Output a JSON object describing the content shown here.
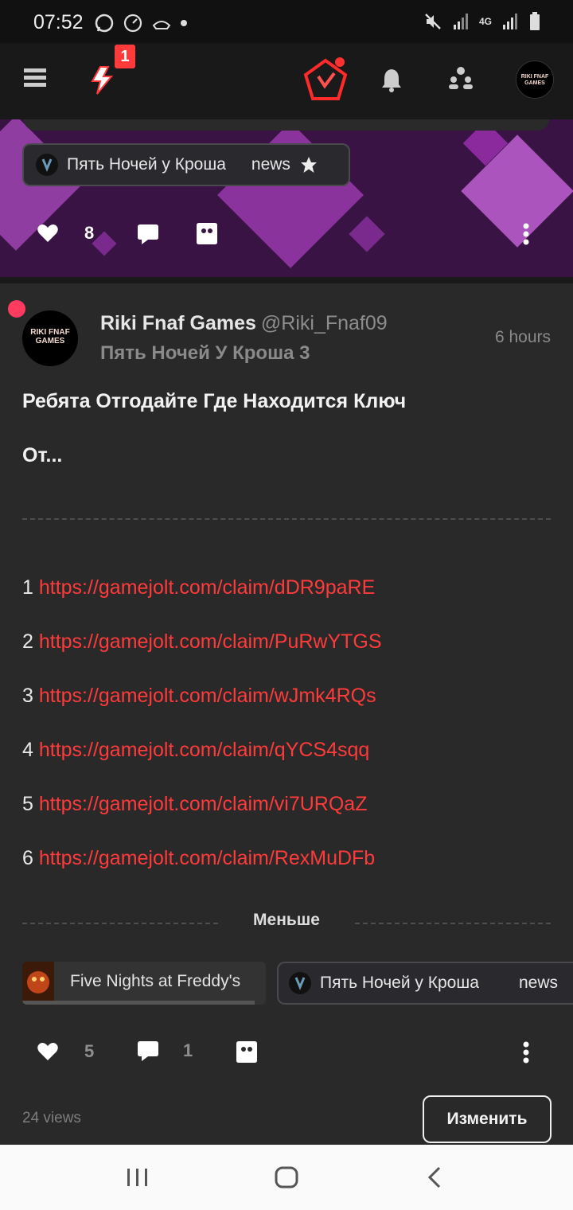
{
  "status_bar": {
    "time": "07:52",
    "network": "4G"
  },
  "header": {
    "menu_icon": "hamburger-icon",
    "activity_badge": "1",
    "avatar_text": "RIKI FNAF GAMES"
  },
  "banner": {
    "like_count": "8",
    "community_tag": {
      "name": "Пять Ночей у Кроша",
      "channel": "news"
    }
  },
  "post": {
    "author_name": "Riki Fnaf Games",
    "author_handle": "@Riki_Fnaf09",
    "avatar_text": "RIKI FNAF GAMES",
    "game_name": "Пять Ночей У Кроша 3",
    "time_ago": "6 hours",
    "title_line1": "Ребята Отгодайте Где Находится Ключ",
    "title_line2": "От...",
    "links": [
      {
        "num": "1",
        "url": "https://gamejolt.com/claim/dDR9paRE"
      },
      {
        "num": "2",
        "url": "https://gamejolt.com/claim/PuRwYTGS"
      },
      {
        "num": "3",
        "url": "https://gamejolt.com/claim/wJmk4RQs"
      },
      {
        "num": "4",
        "url": "https://gamejolt.com/claim/qYCS4sqq"
      },
      {
        "num": "5",
        "url": "https://gamejolt.com/claim/vi7URQaZ"
      },
      {
        "num": "6",
        "url": "https://gamejolt.com/claim/RexMuDFb"
      }
    ],
    "less_label": "Меньше",
    "tags": {
      "game_chip": "Five Nights at Freddy's",
      "community_chip": "Пять Ночей у Кроша",
      "community_channel": "news"
    },
    "likes": "5",
    "comments": "1",
    "views": "24 views",
    "edit_label": "Изменить"
  }
}
